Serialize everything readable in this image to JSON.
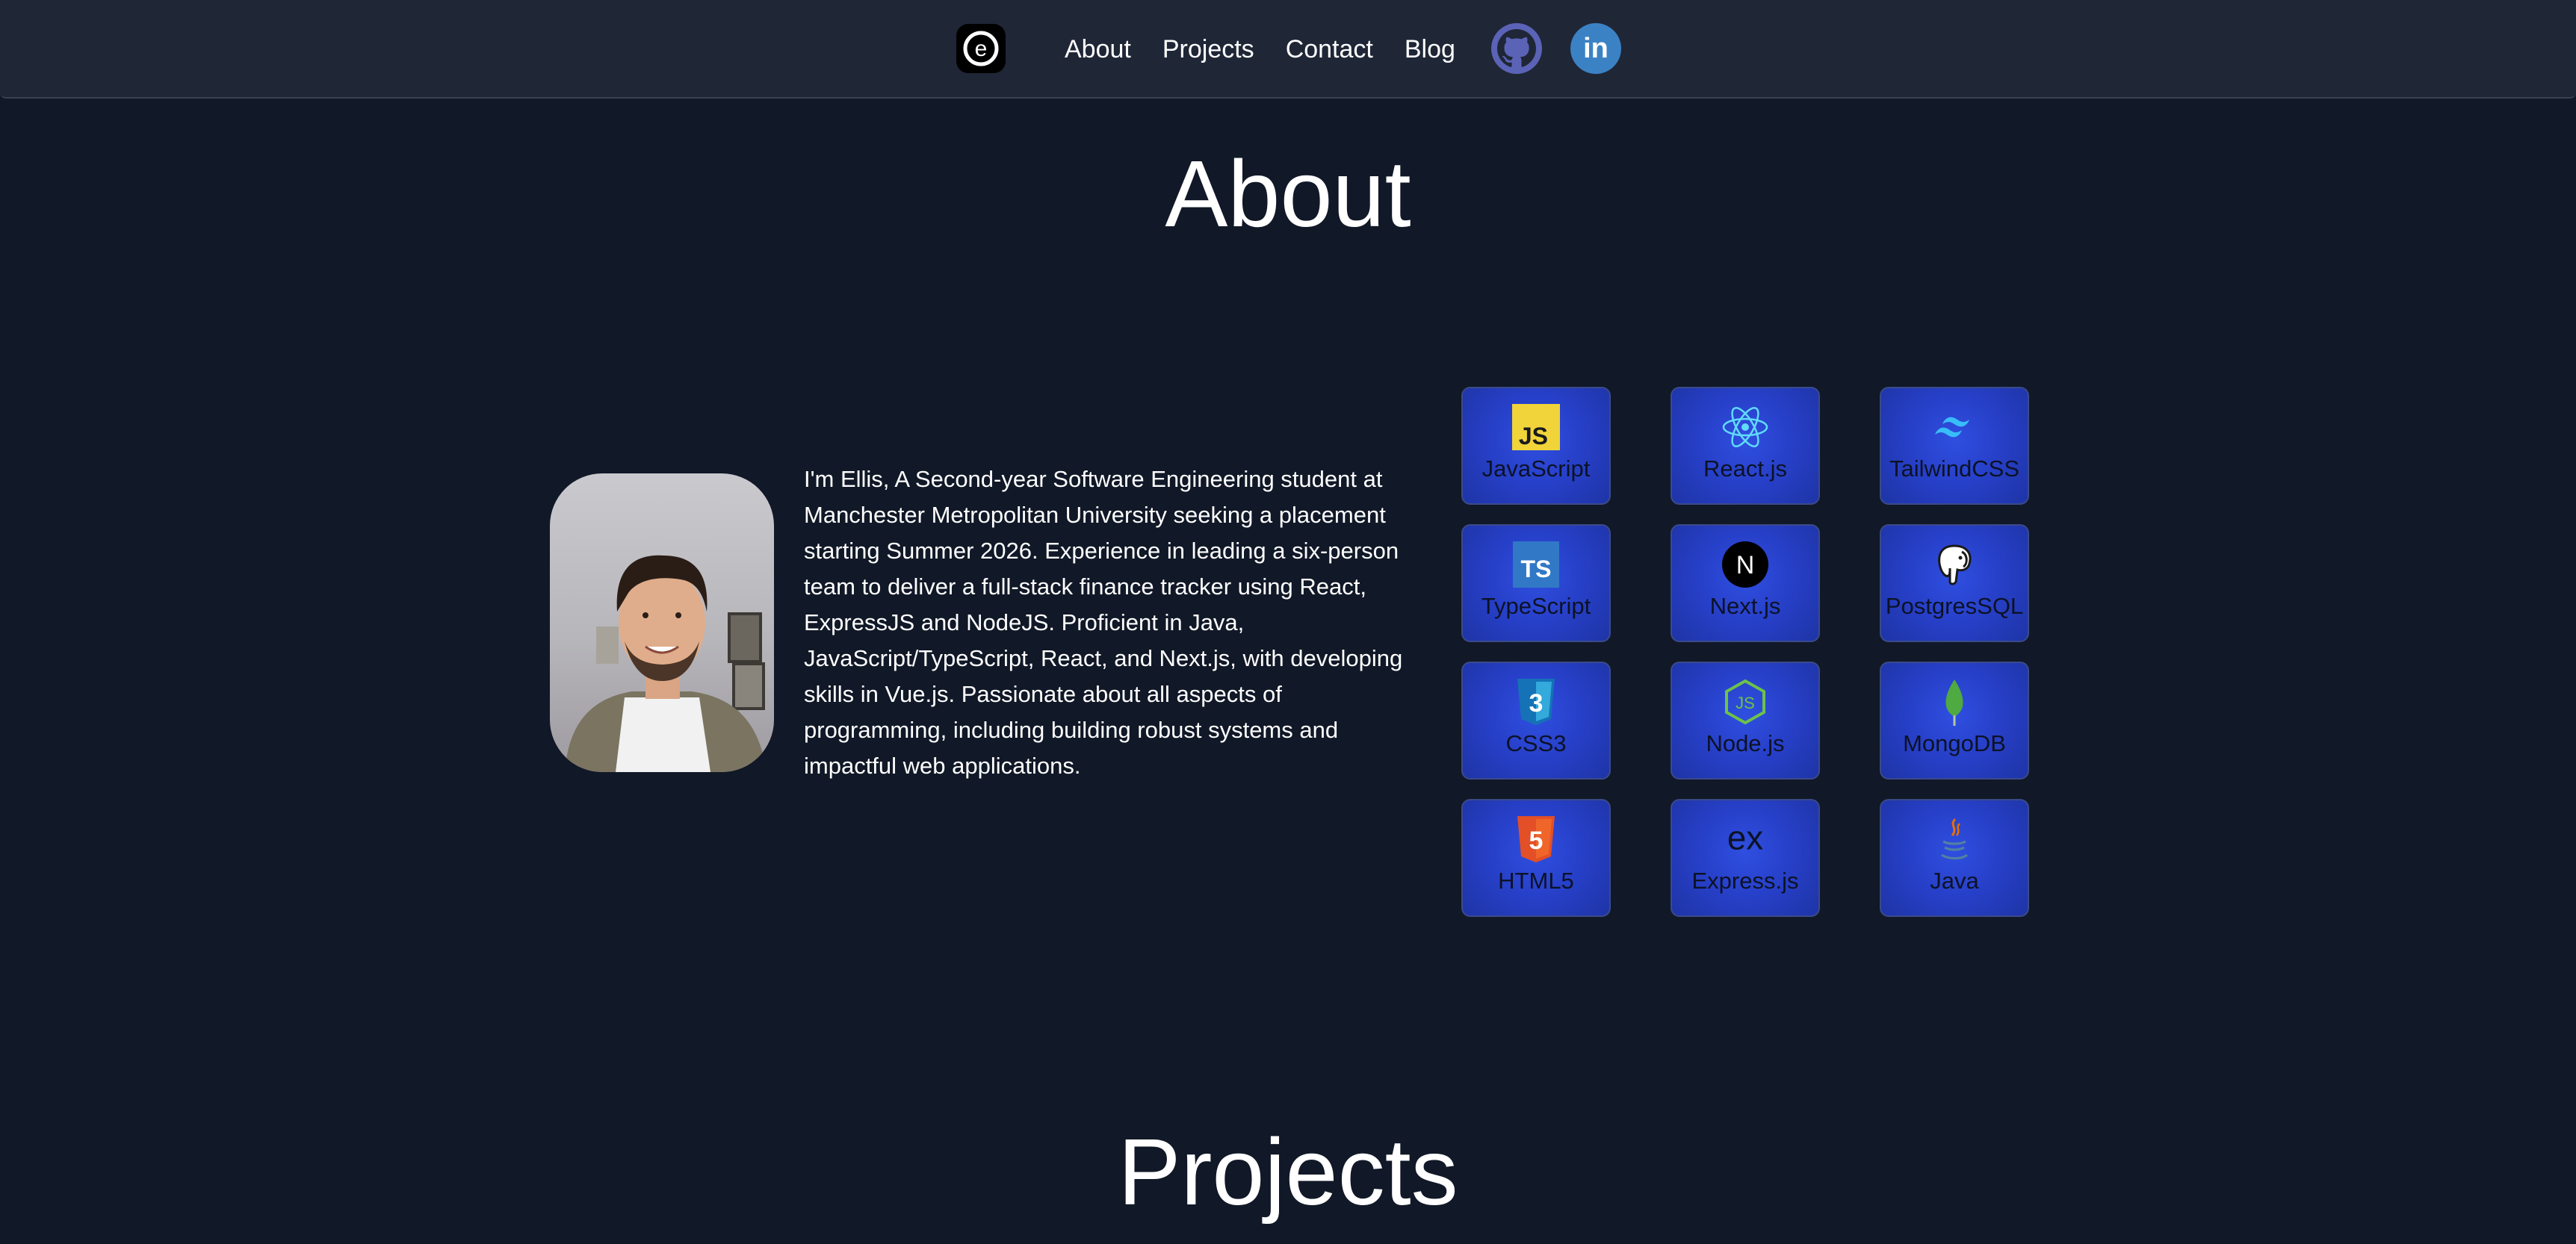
{
  "nav": {
    "logo_letter": "e",
    "links": [
      "About",
      "Projects",
      "Contact",
      "Blog"
    ],
    "social": [
      {
        "name": "GitHub",
        "icon": "github-icon"
      },
      {
        "name": "LinkedIn",
        "icon": "linkedin-icon",
        "text": "in"
      }
    ]
  },
  "about": {
    "heading": "About",
    "bio": "I'm Ellis, A Second-year Software Engineering student at Manchester Metropolitan University seeking a placement starting Summer 2026. Experience in leading a six-person team to deliver a full-stack finance tracker using React, ExpressJS and NodeJS. Proficient in Java, JavaScript/TypeScript, React, and Next.js, with developing skills in Vue.js. Passionate about all aspects of programming, including building robust systems and impactful web applications."
  },
  "skills": [
    {
      "label": "JavaScript",
      "icon": "javascript-icon",
      "badge": "JS"
    },
    {
      "label": "React.js",
      "icon": "react-icon"
    },
    {
      "label": "TailwindCSS",
      "icon": "tailwind-icon"
    },
    {
      "label": "TypeScript",
      "icon": "typescript-icon",
      "badge": "TS"
    },
    {
      "label": "Next.js",
      "icon": "nextjs-icon",
      "badge": "N"
    },
    {
      "label": "PostgresSQL",
      "icon": "postgresql-icon"
    },
    {
      "label": "CSS3",
      "icon": "css3-icon",
      "badge": "3"
    },
    {
      "label": "Node.js",
      "icon": "nodejs-icon",
      "badge": "JS"
    },
    {
      "label": "MongoDB",
      "icon": "mongodb-icon"
    },
    {
      "label": "HTML5",
      "icon": "html5-icon",
      "badge": "5"
    },
    {
      "label": "Express.js",
      "icon": "express-icon",
      "badge": "ex"
    },
    {
      "label": "Java",
      "icon": "java-icon"
    }
  ],
  "projects": {
    "heading": "Projects"
  },
  "colors": {
    "background": "#111827",
    "navbar": "#1f2636",
    "card": "#2740c9",
    "card_text": "#0c1226"
  }
}
